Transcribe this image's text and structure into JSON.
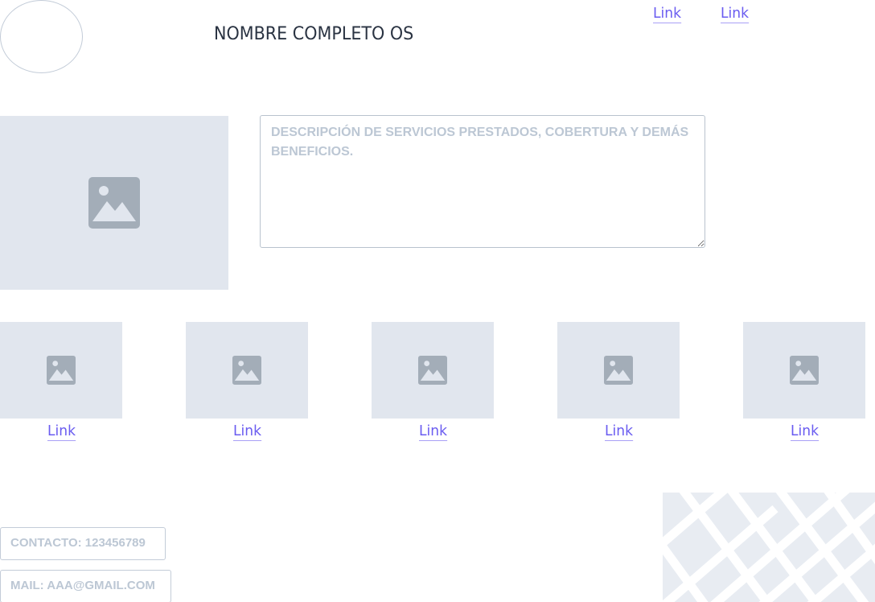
{
  "header": {
    "title": "NOMBRE COMPLETO OS",
    "nav_links": [
      "Link",
      "Link"
    ]
  },
  "hero": {
    "image_icon": "image-icon"
  },
  "description": {
    "placeholder": "DESCRIPCIÓN DE SERVICIOS PRESTADOS, COBERTURA Y DEMÁS BENEFICIOS."
  },
  "gallery": {
    "items": [
      {
        "icon": "image-icon",
        "link": "Link"
      },
      {
        "icon": "image-icon",
        "link": "Link"
      },
      {
        "icon": "image-icon",
        "link": "Link"
      },
      {
        "icon": "image-icon",
        "link": "Link"
      },
      {
        "icon": "image-icon",
        "link": "Link"
      }
    ]
  },
  "contact": {
    "phone": "CONTACTO: 123456789",
    "mail": "MAIL: AAA@GMAIL.COM"
  },
  "map": {
    "icon": "map-placeholder"
  },
  "colors": {
    "link": "#6a5cf0",
    "placeholder_bg": "#e1e6ee",
    "icon": "#a3adb8",
    "border": "#c3ccd8",
    "title": "#2a3342"
  }
}
